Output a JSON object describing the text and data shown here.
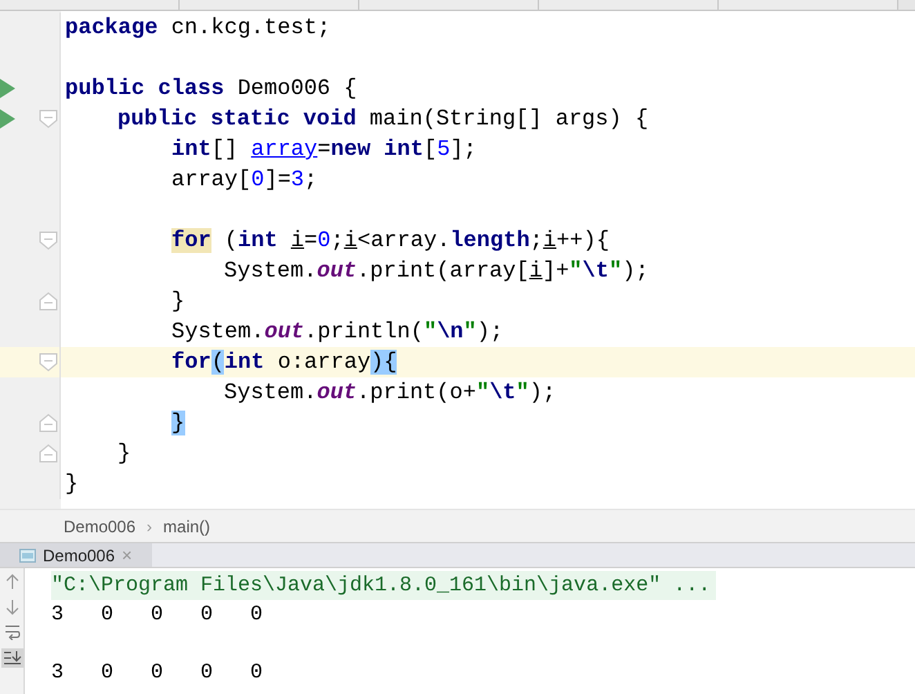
{
  "editor": {
    "lines": [
      {
        "run_marker": false,
        "current": false,
        "tokens": [
          {
            "text": "package",
            "kind": "keyword"
          },
          {
            "text": " cn.kcg.test;",
            "kind": "plain"
          }
        ]
      },
      {
        "run_marker": false,
        "current": false
      },
      {
        "run_marker": true,
        "current": false,
        "tokens": [
          {
            "text": "public class",
            "kind": "keyword"
          },
          {
            "text": " Demo006 {",
            "kind": "plain"
          }
        ],
        "children": [
          {
            "run_marker": true,
            "fold_marker": {
              "kind": "start"
            },
            "current": false,
            "tokens": [
              {
                "text": "public static void",
                "kind": "keyword"
              },
              {
                "text": " main(String[] args) {",
                "kind": "plain"
              }
            ],
            "children": [
              {
                "run_marker": false,
                "current": false,
                "tokens": [
                  {
                    "text": "int",
                    "kind": "keyword"
                  },
                  {
                    "text": "[] ",
                    "kind": "plain"
                  },
                  {
                    "text": "array",
                    "kind": "reassigned-var"
                  },
                  {
                    "text": "=",
                    "kind": "plain"
                  },
                  {
                    "text": "new int",
                    "kind": "keyword"
                  },
                  {
                    "text": "[",
                    "kind": "plain"
                  },
                  {
                    "text": "5",
                    "kind": "number"
                  },
                  {
                    "text": "];",
                    "kind": "plain"
                  }
                ]
              },
              {
                "run_marker": false,
                "current": false,
                "tokens": [
                  {
                    "text": "array[",
                    "kind": "plain"
                  },
                  {
                    "text": "0",
                    "kind": "number"
                  },
                  {
                    "text": "]=",
                    "kind": "plain"
                  },
                  {
                    "text": "3",
                    "kind": "number"
                  },
                  {
                    "text": ";",
                    "kind": "plain"
                  }
                ]
              },
              {
                "run_marker": false,
                "current": false
              },
              {
                "run_marker": false,
                "fold_marker": {
                  "kind": "start"
                },
                "current": false,
                "tokens": [
                  {
                    "text": "for",
                    "kind": "keyword",
                    "highlight": {
                      "kind": "usage"
                    }
                  },
                  {
                    "text": " (",
                    "kind": "plain"
                  },
                  {
                    "text": "int ",
                    "kind": "keyword"
                  },
                  {
                    "text": "i",
                    "kind": "reassigned-local"
                  },
                  {
                    "text": "=",
                    "kind": "plain"
                  },
                  {
                    "text": "0",
                    "kind": "number"
                  },
                  {
                    "text": ";",
                    "kind": "plain"
                  },
                  {
                    "text": "i",
                    "kind": "reassigned-local"
                  },
                  {
                    "text": "<array.",
                    "kind": "plain"
                  },
                  {
                    "text": "length",
                    "kind": "keyword"
                  },
                  {
                    "text": ";",
                    "kind": "plain"
                  },
                  {
                    "text": "i",
                    "kind": "reassigned-local"
                  },
                  {
                    "text": "++){",
                    "kind": "plain"
                  }
                ],
                "children": [
                  {
                    "run_marker": false,
                    "current": false,
                    "tokens": [
                      {
                        "text": "System.",
                        "kind": "plain"
                      },
                      {
                        "text": "out",
                        "kind": "static-field"
                      },
                      {
                        "text": ".print(array[",
                        "kind": "plain"
                      },
                      {
                        "text": "i",
                        "kind": "reassigned-local"
                      },
                      {
                        "text": "]+",
                        "kind": "plain"
                      },
                      {
                        "text": "\"",
                        "kind": "string"
                      },
                      {
                        "text": "\\t",
                        "kind": "escape"
                      },
                      {
                        "text": "\"",
                        "kind": "string"
                      },
                      {
                        "text": ");",
                        "kind": "plain"
                      }
                    ]
                  }
                ]
              },
              {
                "run_marker": false,
                "fold_marker": {
                  "kind": "end"
                },
                "current": false,
                "tokens": [
                  {
                    "text": "}",
                    "kind": "plain"
                  }
                ]
              },
              {
                "run_marker": false,
                "current": false,
                "tokens": [
                  {
                    "text": "System.",
                    "kind": "plain"
                  },
                  {
                    "text": "out",
                    "kind": "static-field"
                  },
                  {
                    "text": ".println(",
                    "kind": "plain"
                  },
                  {
                    "text": "\"",
                    "kind": "string"
                  },
                  {
                    "text": "\\n",
                    "kind": "escape"
                  },
                  {
                    "text": "\"",
                    "kind": "string"
                  },
                  {
                    "text": ");",
                    "kind": "plain"
                  }
                ]
              },
              {
                "run_marker": false,
                "fold_marker": {
                  "kind": "start"
                },
                "current": true,
                "tokens": [
                  {
                    "text": "for",
                    "kind": "keyword"
                  },
                  {
                    "text": "(",
                    "kind": "plain",
                    "highlight": {
                      "kind": "brace-match"
                    }
                  },
                  {
                    "text": "int",
                    "kind": "keyword"
                  },
                  {
                    "text": " o:array",
                    "kind": "plain"
                  },
                  {
                    "text": ")",
                    "kind": "plain",
                    "highlight": {
                      "kind": "brace-match"
                    }
                  },
                  {
                    "text": "{",
                    "kind": "plain",
                    "highlight": {
                      "kind": "brace-match"
                    }
                  }
                ],
                "children": [
                  {
                    "run_marker": false,
                    "current": false,
                    "tokens": [
                      {
                        "text": "System.",
                        "kind": "plain"
                      },
                      {
                        "text": "out",
                        "kind": "static-field"
                      },
                      {
                        "text": ".print(o+",
                        "kind": "plain"
                      },
                      {
                        "text": "\"",
                        "kind": "string"
                      },
                      {
                        "text": "\\t",
                        "kind": "escape"
                      },
                      {
                        "text": "\"",
                        "kind": "string"
                      },
                      {
                        "text": ");",
                        "kind": "plain"
                      }
                    ]
                  }
                ]
              },
              {
                "run_marker": false,
                "fold_marker": {
                  "kind": "end"
                },
                "current": false,
                "tokens": [
                  {
                    "text": "}",
                    "kind": "plain",
                    "highlight": {
                      "kind": "brace-match"
                    }
                  }
                ]
              }
            ]
          },
          {
            "run_marker": false,
            "fold_marker": {
              "kind": "end"
            },
            "current": false,
            "tokens": [
              {
                "text": "}",
                "kind": "plain"
              }
            ]
          }
        ]
      },
      {
        "run_marker": false,
        "current": false,
        "tokens": [
          {
            "text": "}",
            "kind": "plain"
          }
        ]
      }
    ]
  },
  "breadcrumb": {
    "items": [
      "Demo006",
      "main()"
    ],
    "separator": "›"
  },
  "run_panel": {
    "tab": {
      "label": "Demo006",
      "close": "×"
    },
    "console": [
      {
        "kind": "command",
        "text": "\"C:\\Program Files\\Java\\jdk1.8.0_161\\bin\\java.exe\" ..."
      },
      {
        "kind": "output",
        "text": "3\t0\t0\t0\t0"
      },
      {
        "kind": "blank"
      },
      {
        "kind": "output",
        "text": "3\t0\t0\t0\t0"
      }
    ]
  }
}
